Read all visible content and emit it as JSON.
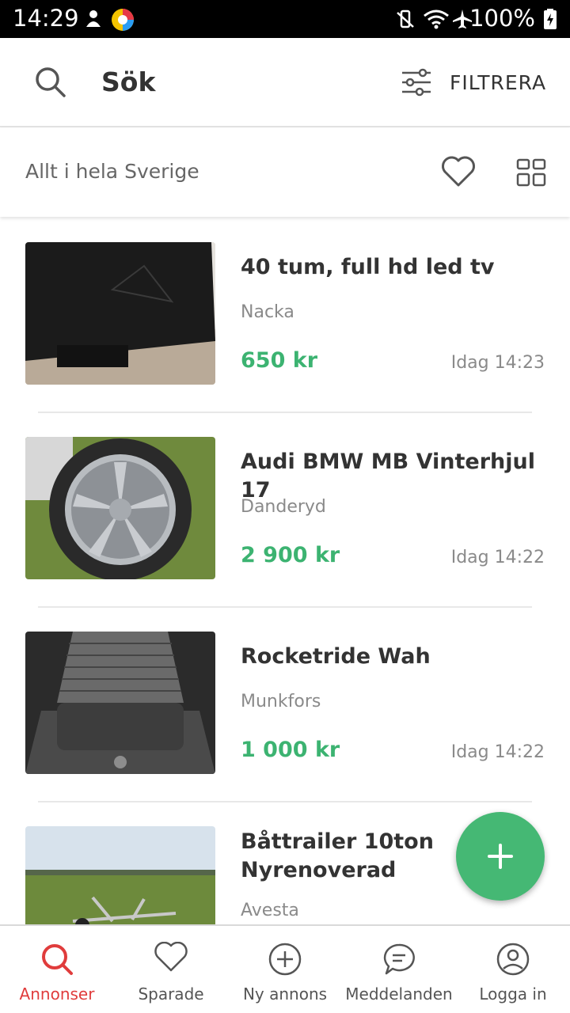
{
  "status_bar": {
    "time": "14:29",
    "battery": "100%",
    "icons": [
      "notification-icon",
      "app-icon",
      "vibrate-icon",
      "wifi-icon",
      "airplane-icon",
      "battery-icon"
    ]
  },
  "header": {
    "title": "Sök",
    "filter_label": "FILTRERA"
  },
  "location_bar": {
    "text": "Allt i hela Sverige"
  },
  "listings": [
    {
      "title": "40 tum, full hd led tv",
      "location": "Nacka",
      "price": "650 kr",
      "time": "Idag 14:23",
      "image": "tv-image"
    },
    {
      "title": "Audi BMW MB Vinterhjul 17",
      "location": "Danderyd",
      "price": "2 900 kr",
      "time": "Idag 14:22",
      "image": "wheel-image"
    },
    {
      "title": "Rocketride Wah",
      "location": "Munkfors",
      "price": "1 000 kr",
      "time": "Idag 14:22",
      "image": "pedal-image"
    },
    {
      "title": "Båttrailer 10ton Nyrenoverad",
      "location": "Avesta",
      "price": "",
      "time": "",
      "image": "trailer-image"
    }
  ],
  "bottom_nav": [
    {
      "label": "Annonser",
      "icon": "search-icon",
      "active": true
    },
    {
      "label": "Sparade",
      "icon": "heart-icon",
      "active": false
    },
    {
      "label": "Ny annons",
      "icon": "add-circle-icon",
      "active": false
    },
    {
      "label": "Meddelanden",
      "icon": "chat-icon",
      "active": false
    },
    {
      "label": "Logga in",
      "icon": "profile-icon",
      "active": false
    }
  ],
  "colors": {
    "accent_green": "#3cb371",
    "fab_green": "#45b874",
    "active_red": "#e03c3c",
    "text_dark": "#333333",
    "text_muted": "#8a8a8a"
  }
}
